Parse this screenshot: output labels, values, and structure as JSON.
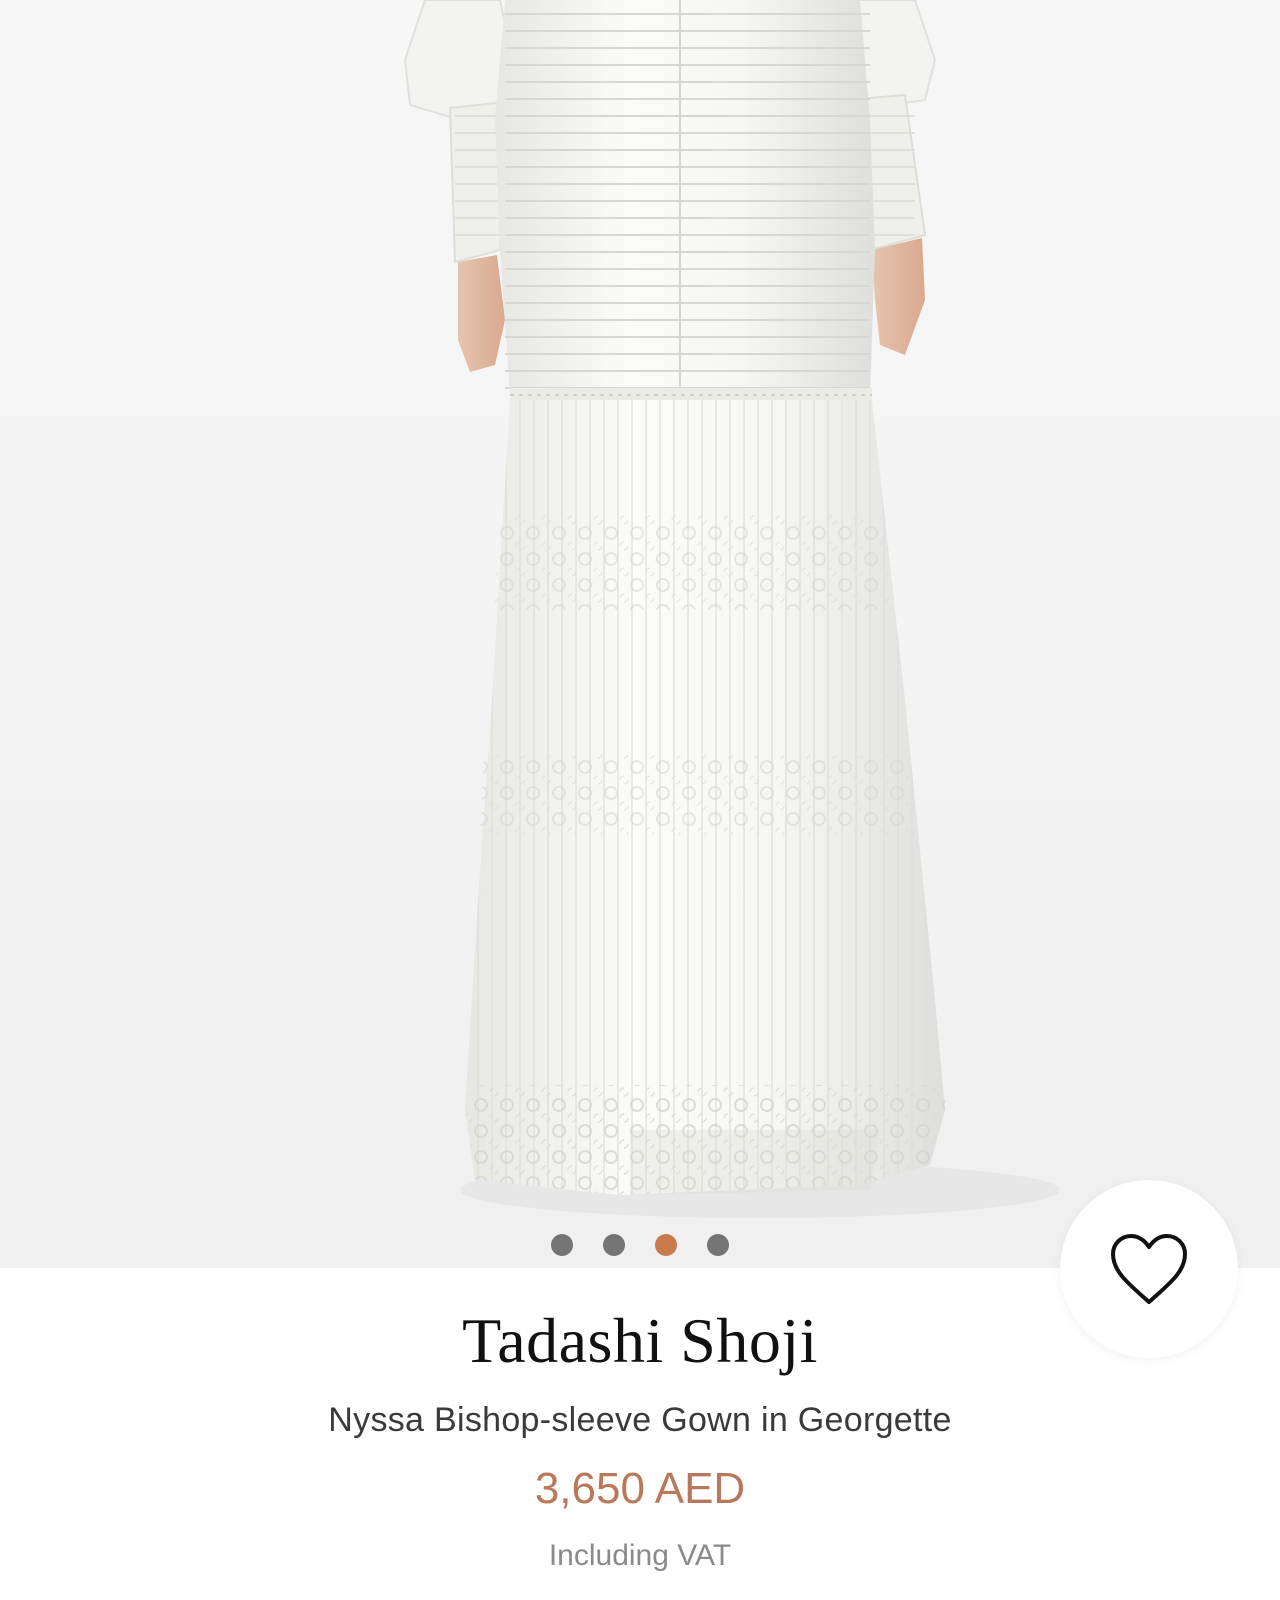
{
  "product": {
    "brand": "Tadashi Shoji",
    "name": "Nyssa Bishop-sleeve Gown in Georgette",
    "price": "3,650 AED",
    "price_note": "Including VAT",
    "price_color": "#b9785a"
  },
  "gallery": {
    "image_count": 4,
    "active_index": 2,
    "dot_color": "#747474",
    "active_dot_color": "#c97a4c"
  },
  "wishlist": {
    "icon": "heart-outline-icon",
    "favorited": false
  }
}
